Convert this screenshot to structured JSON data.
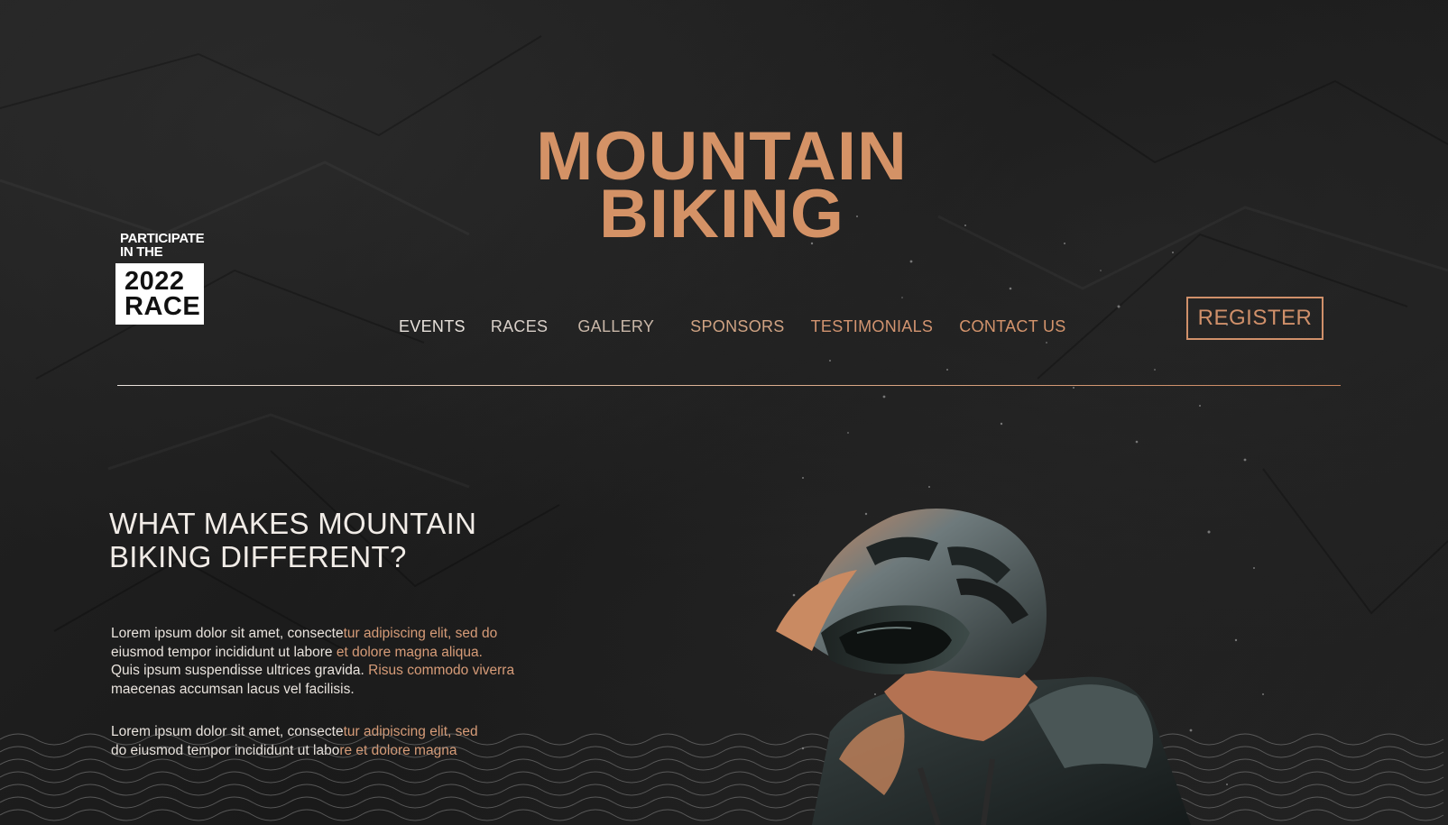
{
  "hero": {
    "title_line1": "MOUNTAIN",
    "title_line2": "BIKING"
  },
  "badge": {
    "top_line1": "PARTICIPATE",
    "top_line2": "IN THE",
    "box_line1": "2022",
    "box_line2": "RACE"
  },
  "nav": {
    "items": [
      {
        "label": "EVENTS"
      },
      {
        "label": "RACES"
      },
      {
        "label": "GALLERY"
      },
      {
        "label": "SPONSORS"
      },
      {
        "label": "TESTIMONIALS"
      },
      {
        "label": "CONTACT US"
      }
    ],
    "register_label": "REGISTER"
  },
  "section": {
    "heading_line1": "WHAT MAKES MOUNTAIN",
    "heading_line2": "BIKING DIFFERENT?",
    "p1": {
      "a": "Lorem ipsum dolor sit amet, consecte",
      "b": "tur adipiscing elit, sed do",
      "c": "eiusmod tempor incididunt ut labore ",
      "d": "et dolore magna aliqua.",
      "e": "Quis ipsum suspendisse ultrices gravida. ",
      "f": "Risus commodo viverra",
      "g": "maecenas accumsan lacus vel facilisis."
    },
    "p2": {
      "a": "Lorem ipsum dolor sit amet, consecte",
      "b": "tur adipiscing elit, sed",
      "c": "do eiusmod tempor incididunt ut labo",
      "d": "re et dolore magna"
    }
  },
  "colors": {
    "accent": "#d4946c",
    "background": "#1c1c1c",
    "text": "#f1ece7"
  },
  "icons": {
    "rider_image": "mountain-biker-helmet-photo"
  }
}
